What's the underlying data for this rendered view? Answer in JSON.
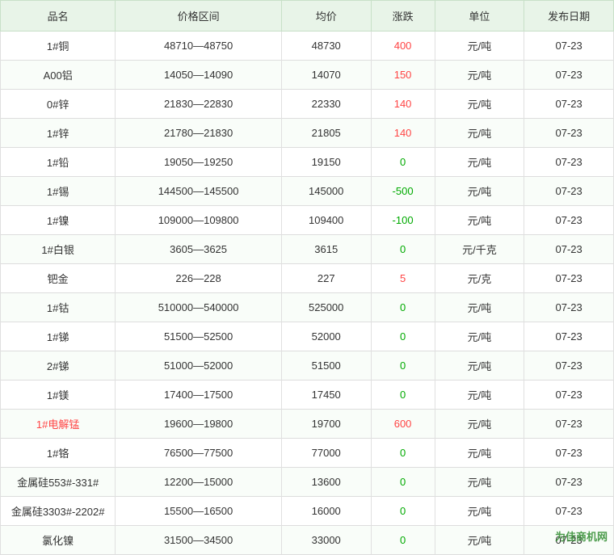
{
  "table": {
    "headers": [
      "品名",
      "价格区间",
      "均价",
      "涨跌",
      "单位",
      "发布日期"
    ],
    "rows": [
      {
        "name": "1#铜",
        "priceRange": "48710—48750",
        "avg": "48730",
        "change": "400",
        "changeType": "rise",
        "unit": "元/吨",
        "date": "07-23",
        "highlight": false
      },
      {
        "name": "A00铝",
        "priceRange": "14050—14090",
        "avg": "14070",
        "change": "150",
        "changeType": "rise",
        "unit": "元/吨",
        "date": "07-23",
        "highlight": false
      },
      {
        "name": "0#锌",
        "priceRange": "21830—22830",
        "avg": "22330",
        "change": "140",
        "changeType": "rise",
        "unit": "元/吨",
        "date": "07-23",
        "highlight": false
      },
      {
        "name": "1#锌",
        "priceRange": "21780—21830",
        "avg": "21805",
        "change": "140",
        "changeType": "rise",
        "unit": "元/吨",
        "date": "07-23",
        "highlight": false
      },
      {
        "name": "1#铅",
        "priceRange": "19050—19250",
        "avg": "19150",
        "change": "0",
        "changeType": "zero",
        "unit": "元/吨",
        "date": "07-23",
        "highlight": false
      },
      {
        "name": "1#锡",
        "priceRange": "144500—145500",
        "avg": "145000",
        "change": "-500",
        "changeType": "fall",
        "unit": "元/吨",
        "date": "07-23",
        "highlight": false
      },
      {
        "name": "1#镍",
        "priceRange": "109000—109800",
        "avg": "109400",
        "change": "-100",
        "changeType": "fall",
        "unit": "元/吨",
        "date": "07-23",
        "highlight": false
      },
      {
        "name": "1#白银",
        "priceRange": "3605—3625",
        "avg": "3615",
        "change": "0",
        "changeType": "zero",
        "unit": "元/千克",
        "date": "07-23",
        "highlight": false
      },
      {
        "name": "钯金",
        "priceRange": "226—228",
        "avg": "227",
        "change": "5",
        "changeType": "rise",
        "unit": "元/克",
        "date": "07-23",
        "highlight": false
      },
      {
        "name": "1#钴",
        "priceRange": "510000—540000",
        "avg": "525000",
        "change": "0",
        "changeType": "zero",
        "unit": "元/吨",
        "date": "07-23",
        "highlight": false
      },
      {
        "name": "1#锑",
        "priceRange": "51500—52500",
        "avg": "52000",
        "change": "0",
        "changeType": "zero",
        "unit": "元/吨",
        "date": "07-23",
        "highlight": false
      },
      {
        "name": "2#锑",
        "priceRange": "51000—52000",
        "avg": "51500",
        "change": "0",
        "changeType": "zero",
        "unit": "元/吨",
        "date": "07-23",
        "highlight": false
      },
      {
        "name": "1#镁",
        "priceRange": "17400—17500",
        "avg": "17450",
        "change": "0",
        "changeType": "zero",
        "unit": "元/吨",
        "date": "07-23",
        "highlight": false
      },
      {
        "name": "1#电解锰",
        "priceRange": "19600—19800",
        "avg": "19700",
        "change": "600",
        "changeType": "rise",
        "unit": "元/吨",
        "date": "07-23",
        "highlight": true
      },
      {
        "name": "1#铬",
        "priceRange": "76500—77500",
        "avg": "77000",
        "change": "0",
        "changeType": "zero",
        "unit": "元/吨",
        "date": "07-23",
        "highlight": false
      },
      {
        "name": "金属硅553#-331#",
        "priceRange": "12200—15000",
        "avg": "13600",
        "change": "0",
        "changeType": "zero",
        "unit": "元/吨",
        "date": "07-23",
        "highlight": false
      },
      {
        "name": "金属硅3303#-2202#",
        "priceRange": "15500—16500",
        "avg": "16000",
        "change": "0",
        "changeType": "zero",
        "unit": "元/吨",
        "date": "07-23",
        "highlight": false
      },
      {
        "name": "氯化镍",
        "priceRange": "31500—34500",
        "avg": "33000",
        "change": "0",
        "changeType": "zero",
        "unit": "元/吨",
        "date": "07-23",
        "highlight": false
      }
    ]
  },
  "watermark": "为佳商机网"
}
